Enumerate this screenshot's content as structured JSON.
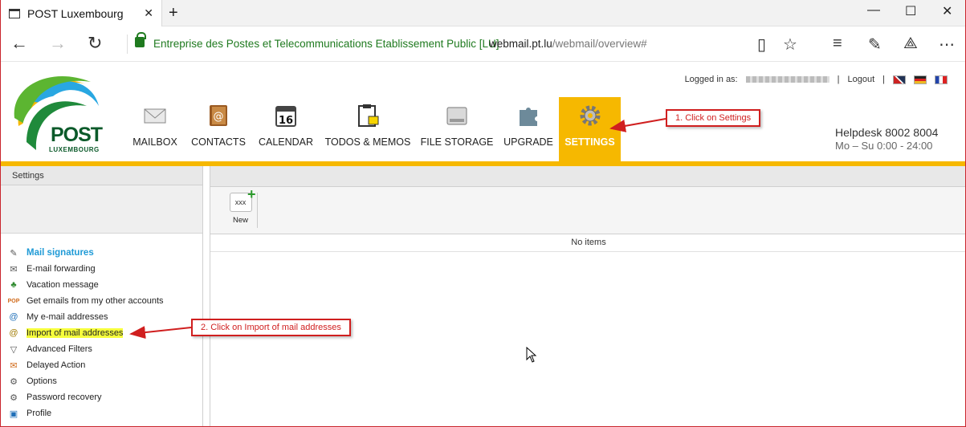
{
  "browser": {
    "tab_title": "POST Luxembourg",
    "site_identity": "Entreprise des Postes et Telecommunications Etablissement Public [LU]",
    "url_host": "webmail.pt.lu",
    "url_path": "/webmail/overview#"
  },
  "header": {
    "logo_text": "POST",
    "logo_subtext": "LUXEMBOURG",
    "logged_in_label": "Logged in as:",
    "logout_label": "Logout",
    "helpdesk": "Helpdesk 8002 8004",
    "hours": "Mo – Su 0:00 - 24:00",
    "nav": [
      {
        "label": "MAILBOX",
        "icon": "mail-envelope-icon"
      },
      {
        "label": "CONTACTS",
        "icon": "address-book-icon"
      },
      {
        "label": "CALENDAR",
        "icon": "calendar-icon"
      },
      {
        "label": "TODOS & MEMOS",
        "icon": "clipboard-icon"
      },
      {
        "label": "FILE STORAGE",
        "icon": "hard-drive-icon"
      },
      {
        "label": "UPGRADE",
        "icon": "puzzle-icon"
      },
      {
        "label": "SETTINGS",
        "icon": "gear-icon"
      }
    ],
    "calendar_day": "16",
    "accent_color": "#f6b800"
  },
  "sidebar": {
    "title": "Settings",
    "items": [
      {
        "label": "Mail signatures",
        "icon": "pen-icon"
      },
      {
        "label": "E-mail forwarding",
        "icon": "forward-icon"
      },
      {
        "label": "Vacation message",
        "icon": "palm-tree-icon"
      },
      {
        "label": "Get emails from my other accounts",
        "icon": "pop-icon"
      },
      {
        "label": "My e-mail addresses",
        "icon": "at-sign-icon"
      },
      {
        "label": "Import of mail addresses",
        "icon": "import-icon"
      },
      {
        "label": "Advanced Filters",
        "icon": "funnel-icon"
      },
      {
        "label": "Delayed Action",
        "icon": "delayed-mail-icon"
      },
      {
        "label": "Options",
        "icon": "gear-icon"
      },
      {
        "label": "Password recovery",
        "icon": "gear-icon"
      },
      {
        "label": "Profile",
        "icon": "profile-icon"
      }
    ]
  },
  "content": {
    "new_label": "New",
    "new_icon_text": "xxx",
    "empty_text": "No items"
  },
  "annotations": {
    "step1": "1. Click on Settings",
    "step2": "2. Click on Import of mail addresses",
    "color": "#d01f1f"
  }
}
